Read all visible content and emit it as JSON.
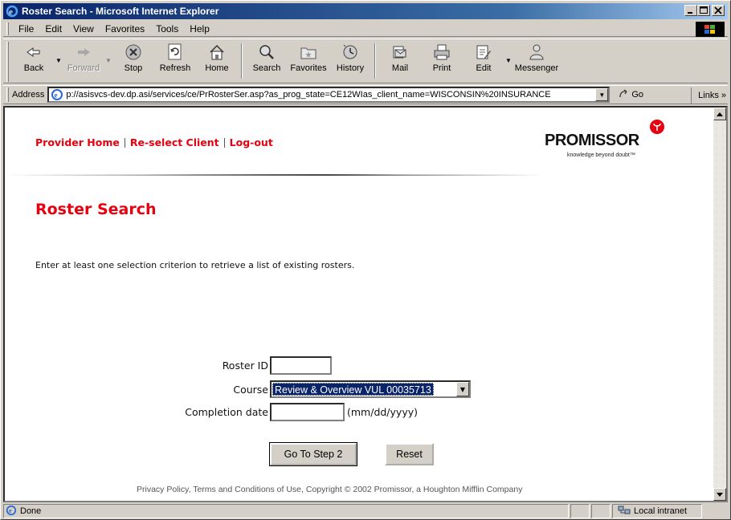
{
  "window": {
    "title": "Roster Search - Microsoft Internet Explorer",
    "caption_buttons": [
      "minimize",
      "maximize",
      "close"
    ]
  },
  "menu": [
    "File",
    "Edit",
    "View",
    "Favorites",
    "Tools",
    "Help"
  ],
  "toolbar": {
    "back": "Back",
    "forward": "Forward",
    "stop": "Stop",
    "refresh": "Refresh",
    "home": "Home",
    "search": "Search",
    "favorites": "Favorites",
    "history": "History",
    "mail": "Mail",
    "print": "Print",
    "edit": "Edit",
    "messenger": "Messenger"
  },
  "address": {
    "label": "Address",
    "url": "p://asisvcs-dev.dp.asi/services/ce/PrRosterSer.asp?as_prog_state=CE12WIas_client_name=WISCONSIN%20INSURANCE",
    "go": "Go",
    "links": "Links »"
  },
  "page": {
    "nav": [
      "Provider Home",
      "Re-select Client",
      "Log-out"
    ],
    "logo": {
      "word": "PROMISSOR",
      "tagline": "knowledge beyond doubt™"
    },
    "title": "Roster Search",
    "instructions": "Enter at least one selection criterion to retrieve a list of existing rosters.",
    "form": {
      "roster_id_label": "Roster ID",
      "roster_id_value": "",
      "course_label": "Course",
      "course_value": "Review & Overview VUL 00035713",
      "completion_label": "Completion date",
      "completion_value": "",
      "date_hint": "(mm/dd/yyyy)",
      "submit": "Go To Step 2",
      "reset": "Reset"
    },
    "footer": "Privacy Policy, Terms and Conditions of Use,  Copyright © 2002 Promissor,  a Houghton Mifflin Company"
  },
  "status": {
    "text": "Done",
    "zone": "Local intranet"
  },
  "colors": {
    "accent_red": "#e8000f",
    "titlebar_start": "#0a246a",
    "titlebar_end": "#a6caf0",
    "selection": "#0a246a"
  }
}
